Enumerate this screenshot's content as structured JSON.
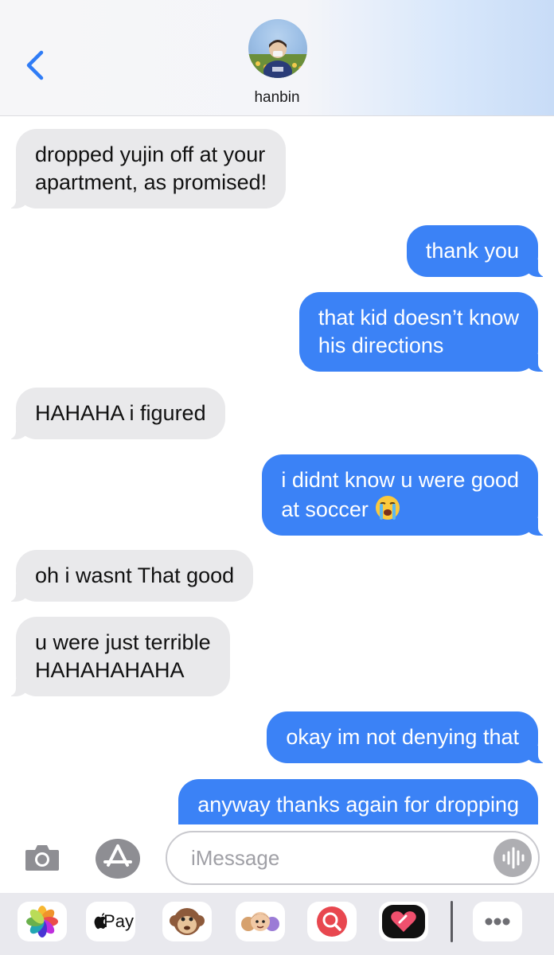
{
  "header": {
    "contact_name": "hanbin"
  },
  "messages": [
    {
      "side": "in",
      "lines": [
        "dropped yujin off at your",
        "apartment, as promised!"
      ]
    },
    {
      "side": "out",
      "lines": [
        "thank you"
      ]
    },
    {
      "side": "out",
      "lines": [
        "that kid doesn’t know",
        "his directions"
      ]
    },
    {
      "side": "in",
      "lines": [
        "HAHAHA i figured"
      ]
    },
    {
      "side": "out",
      "lines": [
        "i didnt know u were good",
        "at soccer"
      ]
    },
    {
      "side": "in",
      "lines": [
        "oh i wasnt That good"
      ]
    },
    {
      "side": "in",
      "lines": [
        "u were just terrible",
        "HAHAHAHAHA"
      ]
    },
    {
      "side": "out",
      "lines": [
        "okay im not denying that"
      ]
    },
    {
      "side": "out",
      "lines": [
        "anyway thanks again for dropping"
      ]
    }
  ],
  "input": {
    "placeholder": "iMessage"
  },
  "drawer": {
    "apple_pay_label": "Pay",
    "apps": [
      "photos-icon",
      "apple-pay-icon",
      "monkey-emoji-icon",
      "memoji-icon",
      "image-search-icon",
      "digital-touch-icon",
      "more-icon"
    ]
  },
  "colors": {
    "outgoing": "#3b82f6",
    "incoming": "#e9e9eb",
    "accent": "#2f7cf6"
  }
}
